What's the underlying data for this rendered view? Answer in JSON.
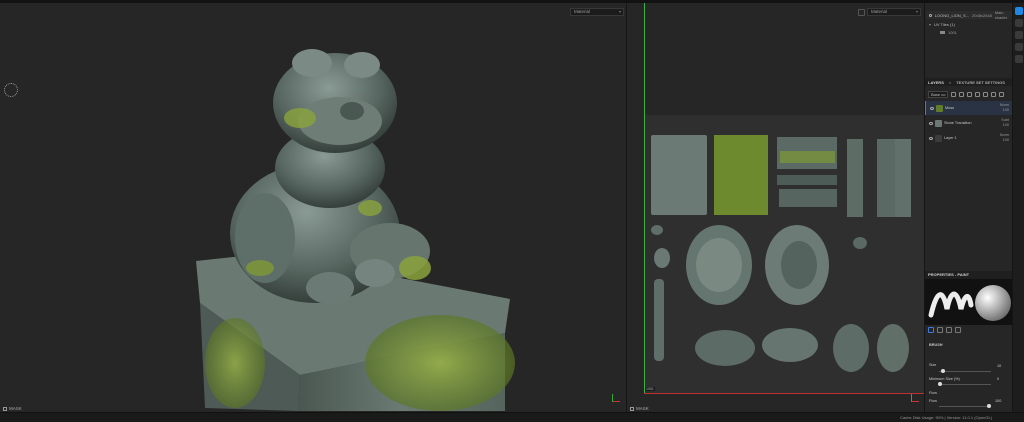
{
  "viewport3d": {
    "channel": "Material",
    "footer_label": "MASK"
  },
  "viewport2d": {
    "channel": "Material",
    "footer_label": "MASK",
    "uv_label": "1001"
  },
  "texture_sets": {
    "set_name": "LOONG_LION_S...",
    "resolution": "2048x2048",
    "shader": "Main shader",
    "uv_tile_label": "UV Tiles (1)",
    "uv_tile_value": "1001"
  },
  "layers_panel": {
    "tab_layers": "LAYERS",
    "tab_settings": "TEXTURE SET SETTINGS",
    "blend_dropdown": "Base co",
    "layers": [
      {
        "name": "Moss",
        "blend": "Norm",
        "opacity": "100",
        "thumb_color": "#5f7c2c",
        "selected": true
      },
      {
        "name": "Stone Transition",
        "blend": "Subt",
        "opacity": "100",
        "thumb_color": "#6f7774",
        "selected": false
      },
      {
        "name": "Layer 1",
        "blend": "Norm",
        "opacity": "100",
        "thumb_color": "#3a3d3c",
        "selected": false
      }
    ]
  },
  "properties": {
    "header": "PROPERTIES - PAINT",
    "section_brush": "BRUSH",
    "size_label": "Size",
    "size_value": "10",
    "min_size_label": "Minimum Size (%)",
    "min_size_value": "0",
    "flow_section": "Flow",
    "flow_label": "Flow",
    "flow_value": "100"
  },
  "status": {
    "text": "Cache Disk Usage:  90%  |  Version: 11.0.1 (OpenGL)"
  },
  "colors": {
    "accent": "#1e88e5",
    "uv_green": "#3fb34a",
    "uv_red": "#c03030",
    "moss": "#6d8a2a",
    "stone": "#5d6d68"
  }
}
